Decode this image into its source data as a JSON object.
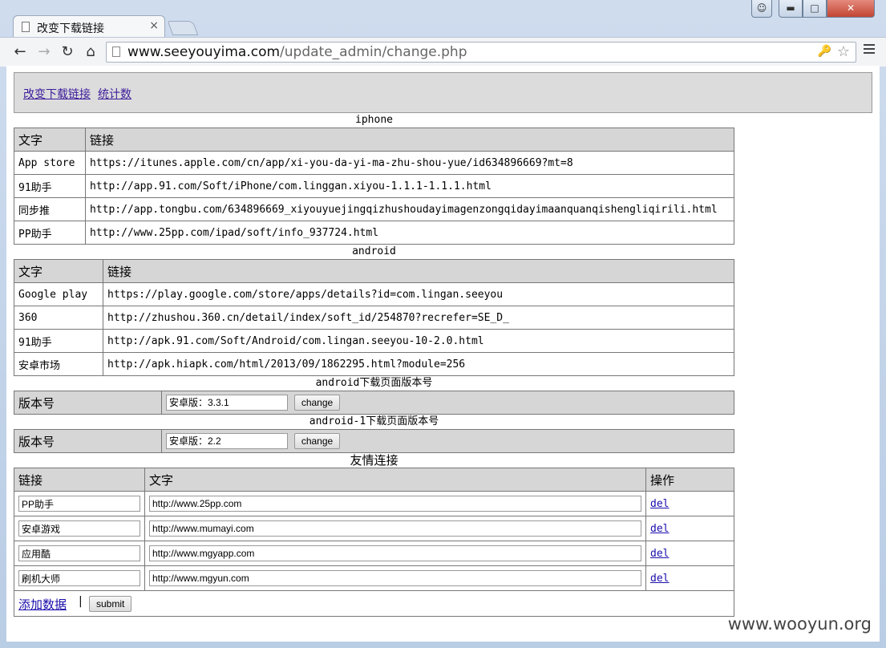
{
  "browser": {
    "tab_title": "改变下载链接",
    "tab_close": "×",
    "url_host": "www.seeyouyima.com",
    "url_path": "/update_admin/change.php"
  },
  "nav": {
    "links": [
      "改变下载链接",
      "统计数"
    ]
  },
  "iphone": {
    "caption": "iphone",
    "headers": [
      "文字",
      "链接"
    ],
    "rows": [
      [
        "App store",
        "https://itunes.apple.com/cn/app/xi-you-da-yi-ma-zhu-shou-yue/id634896669?mt=8"
      ],
      [
        "91助手",
        "http://app.91.com/Soft/iPhone/com.linggan.xiyou-1.1.1-1.1.1.html"
      ],
      [
        "同步推",
        "http://app.tongbu.com/634896669_xiyouyuejingqizhushoudayimagenzongqidayimaanquanqishengliqirili.html"
      ],
      [
        "PP助手",
        "http://www.25pp.com/ipad/soft/info_937724.html"
      ]
    ]
  },
  "android": {
    "caption": "android",
    "headers": [
      "文字",
      "链接"
    ],
    "rows": [
      [
        "Google play",
        "https://play.google.com/store/apps/details?id=com.lingan.seeyou"
      ],
      [
        "360",
        "http://zhushou.360.cn/detail/index/soft_id/254870?recrefer=SE_D_"
      ],
      [
        "91助手",
        "http://apk.91.com/Soft/Android/com.lingan.seeyou-10-2.0.html"
      ],
      [
        "安卓市场",
        "http://apk.hiapk.com/html/2013/09/1862295.html?module=256"
      ]
    ]
  },
  "android_version": {
    "caption": "android下载页面版本号",
    "label": "版本号",
    "value": "安卓版：3.3.1",
    "button": "change"
  },
  "android1_version": {
    "caption": "android-1下载页面版本号",
    "label": "版本号",
    "value": "安卓版：2.2",
    "button": "change"
  },
  "friends": {
    "caption": "友情连接",
    "headers": [
      "链接",
      "文字",
      "操作"
    ],
    "rows": [
      {
        "name": "PP助手",
        "url": "http://www.25pp.com",
        "action": "del"
      },
      {
        "name": "安卓游戏",
        "url": "http://www.mumayi.com",
        "action": "del"
      },
      {
        "name": "应用酷",
        "url": "http://www.mgyapp.com",
        "action": "del"
      },
      {
        "name": "刷机大师",
        "url": "http://www.mgyun.com",
        "action": "del"
      }
    ],
    "add_label": "添加数据",
    "separator": "|",
    "submit_label": "submit"
  },
  "watermark": "www.wooyun.org"
}
